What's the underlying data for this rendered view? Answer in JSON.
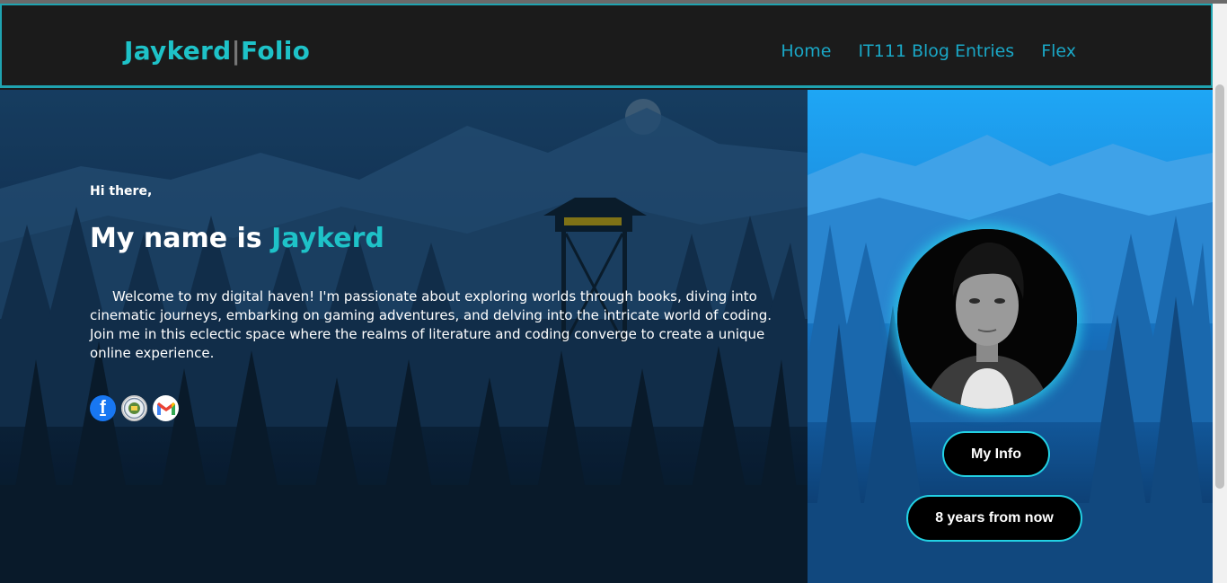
{
  "header": {
    "logo_part1": "Jaykerd",
    "logo_sep": "|",
    "logo_part2": "Folio",
    "nav": [
      {
        "label": "Home"
      },
      {
        "label": "IT111 Blog Entries"
      },
      {
        "label": "Flex"
      }
    ]
  },
  "hero": {
    "greeting": "Hi there,",
    "title_prefix": "My name is ",
    "title_name": "Jaykerd",
    "description": "Welcome to my digital haven! I'm passionate about exploring worlds through books, diving into cinematic journeys, embarking on gaming adventures, and delving into the intricate world of coding. Join me in this eclectic space where the realms of literature and coding converge to create a unique online experience.",
    "socials": [
      {
        "icon": "facebook-icon",
        "glyph": "f"
      },
      {
        "icon": "school-seal-icon"
      },
      {
        "icon": "gmail-icon"
      }
    ]
  },
  "sidebar": {
    "avatar": "profile-photo",
    "buttons": [
      {
        "label": "My Info"
      },
      {
        "label": "8 years from now"
      }
    ]
  },
  "colors": {
    "accent": "#1ec2c8",
    "nav_link": "#1aa7c6",
    "navbar_bg": "#1b1b1b",
    "button_border": "#22d1e4"
  }
}
